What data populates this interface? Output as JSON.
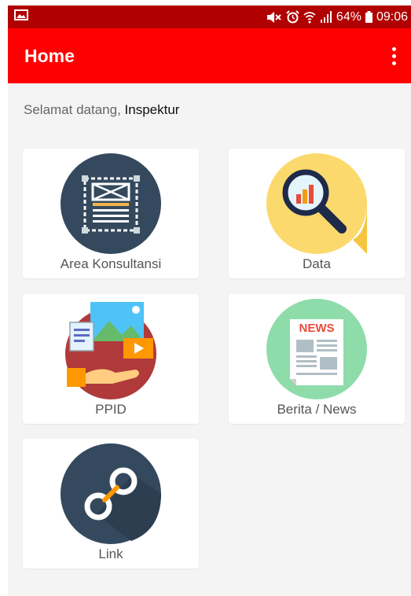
{
  "status_bar": {
    "battery": "64%",
    "time": "09:06"
  },
  "app_bar": {
    "title": "Home"
  },
  "greeting": {
    "prefix": "Selamat datang,",
    "name": "Inspektur"
  },
  "menu": [
    {
      "label": "Area Konsultansi",
      "icon": "document-frame-icon"
    },
    {
      "label": "Data",
      "icon": "magnifier-chart-icon"
    },
    {
      "label": "PPID",
      "icon": "media-hand-icon"
    },
    {
      "label": "Berita / News",
      "icon": "newspaper-icon"
    },
    {
      "label": "Link",
      "icon": "link-icon"
    }
  ],
  "icons": {
    "newspaper_heading": "NEWS"
  },
  "colors": {
    "status_bar": "#b00000",
    "app_bar": "#ff0000",
    "background": "#f4f4f4"
  }
}
